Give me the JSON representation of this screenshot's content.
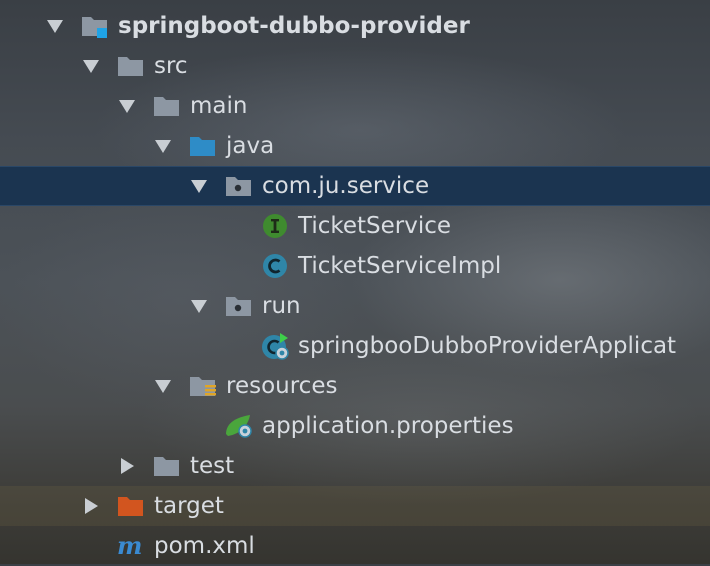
{
  "tree": {
    "items": [
      {
        "label": "springboot-dubbo-provider",
        "icon": "module-folder-icon",
        "state": "expanded"
      },
      {
        "label": "src",
        "icon": "folder-icon",
        "state": "expanded"
      },
      {
        "label": "main",
        "icon": "folder-icon",
        "state": "expanded"
      },
      {
        "label": "java",
        "icon": "source-root-folder-icon",
        "state": "expanded"
      },
      {
        "label": "com.ju.service",
        "icon": "package-icon",
        "state": "expanded",
        "selected": true
      },
      {
        "label": "TicketService",
        "icon": "interface-icon"
      },
      {
        "label": "TicketServiceImpl",
        "icon": "class-icon"
      },
      {
        "label": "run",
        "icon": "package-icon",
        "state": "expanded"
      },
      {
        "label": "springbooDubboProviderApplicat",
        "icon": "spring-boot-class-icon"
      },
      {
        "label": "resources",
        "icon": "resources-folder-icon",
        "state": "expanded"
      },
      {
        "label": "application.properties",
        "icon": "spring-properties-icon"
      },
      {
        "label": "test",
        "icon": "folder-icon",
        "state": "collapsed"
      },
      {
        "label": "target",
        "icon": "excluded-folder-icon",
        "state": "collapsed"
      },
      {
        "label": "pom.xml",
        "icon": "maven-icon"
      }
    ]
  },
  "colors": {
    "selection": "#1b3450",
    "text": "#d9dde2",
    "folder": "#8d97a3",
    "source_folder": "#2e8cc7",
    "excluded_folder": "#d2551f",
    "interface_badge": "#3f8b2f",
    "class_badge": "#2f86a8",
    "maven": "#3a8ad1"
  }
}
